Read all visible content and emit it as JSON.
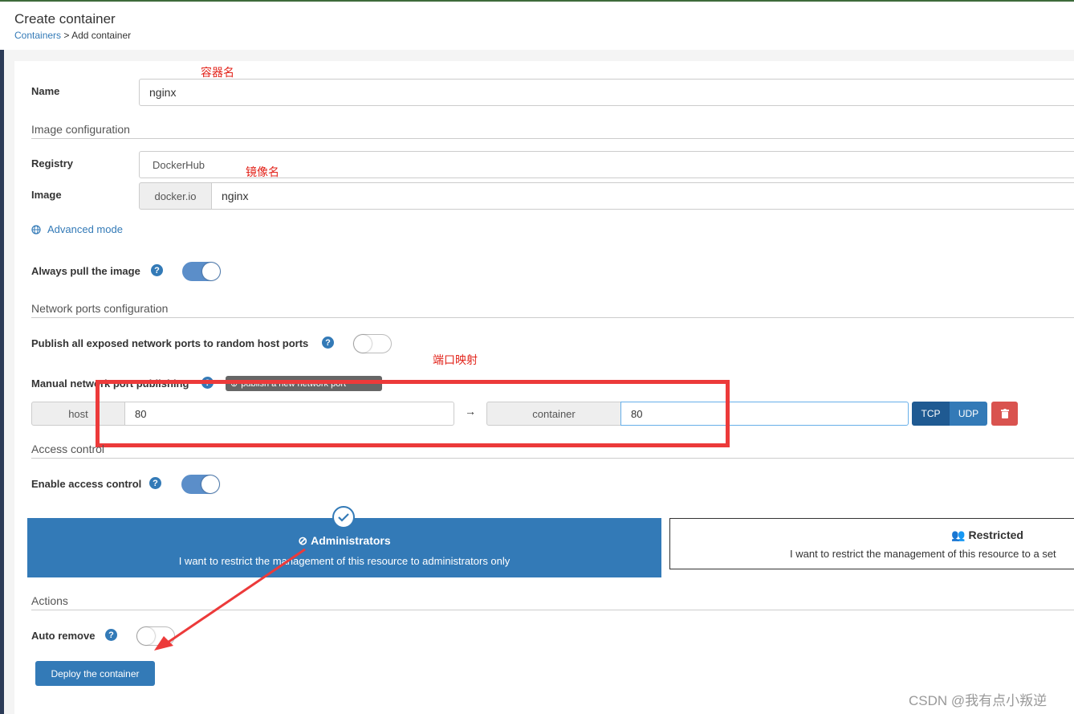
{
  "header": {
    "title": "Create container",
    "breadcrumb_link": "Containers",
    "breadcrumb_sep": ">",
    "breadcrumb_current": "Add container"
  },
  "annotations": {
    "container_name": "容器名",
    "image_name": "镜像名",
    "port_mapping": "端口映射",
    "watermark": "CSDN @我有点小叛逆"
  },
  "name": {
    "label": "Name",
    "value": "nginx"
  },
  "image_section": {
    "title": "Image configuration"
  },
  "registry": {
    "label": "Registry",
    "value": "DockerHub"
  },
  "image": {
    "label": "Image",
    "prefix": "docker.io",
    "value": "nginx"
  },
  "advanced_mode": {
    "label": "Advanced mode"
  },
  "always_pull": {
    "label": "Always pull the image",
    "on": true
  },
  "ports_section": {
    "title": "Network ports configuration"
  },
  "publish_all": {
    "label": "Publish all exposed network ports to random host ports",
    "on": false
  },
  "manual_ports": {
    "label": "Manual network port publishing",
    "add_button": "publish a new network port"
  },
  "port_row": {
    "host_label": "host",
    "host_value": "80",
    "arrow": "→",
    "container_label": "container",
    "container_value": "80",
    "tcp": "TCP",
    "udp": "UDP"
  },
  "access_section": {
    "title": "Access control"
  },
  "enable_access": {
    "label": "Enable access control",
    "on": true
  },
  "access_admin": {
    "title": "Administrators",
    "desc": "I want to restrict the management of this resource to administrators only",
    "selected": true
  },
  "access_restricted": {
    "title": "Restricted",
    "desc": "I want to restrict the management of this resource to a set"
  },
  "actions_section": {
    "title": "Actions"
  },
  "auto_remove": {
    "label": "Auto remove",
    "on": false
  },
  "deploy_button": "Deploy the container",
  "colors": {
    "primary": "#337ab7",
    "danger": "#d9534f",
    "annotation": "#ec3a3a",
    "toggle_on": "#5b8ec9"
  }
}
